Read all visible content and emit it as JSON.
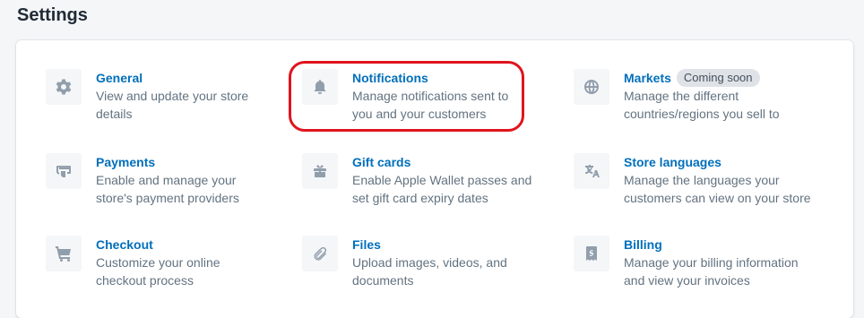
{
  "page": {
    "title": "Settings"
  },
  "settings": [
    {
      "key": "general",
      "icon": "gear-icon",
      "title": "General",
      "description": "View and update your store details",
      "desc_lines": [
        "View and update your store",
        "details"
      ]
    },
    {
      "key": "notifications",
      "icon": "bell-icon",
      "title": "Notifications",
      "description": "Manage notifications sent to you and your customers",
      "desc_lines": [
        "Manage notifications sent to",
        "you and your customers"
      ]
    },
    {
      "key": "markets",
      "icon": "globe-icon",
      "title": "Markets",
      "badge": "Coming soon",
      "description": "Manage the different countries/regions you sell to",
      "desc_lines": [
        "Manage the different",
        "countries/regions you sell to"
      ]
    },
    {
      "key": "payments",
      "icon": "credit-card-icon",
      "title": "Payments",
      "description": "Enable and manage your store's payment providers",
      "desc_lines": [
        "Enable and manage your",
        "store's payment providers"
      ]
    },
    {
      "key": "gift-cards",
      "icon": "gift-icon",
      "title": "Gift cards",
      "description": "Enable Apple Wallet passes and set gift card expiry dates",
      "desc_lines": [
        "Enable Apple Wallet passes and",
        "set gift card expiry dates"
      ]
    },
    {
      "key": "store-languages",
      "icon": "translate-icon",
      "title": "Store languages",
      "description": "Manage the languages your customers can view on your store",
      "desc_lines": [
        "Manage the languages your",
        "customers can view on your store"
      ]
    },
    {
      "key": "checkout",
      "icon": "cart-icon",
      "title": "Checkout",
      "description": "Customize your online checkout process",
      "desc_lines": [
        "Customize your online",
        "checkout process"
      ]
    },
    {
      "key": "files",
      "icon": "paperclip-icon",
      "title": "Files",
      "description": "Upload images, videos, and documents",
      "desc_lines": [
        "Upload images, videos, and",
        "documents"
      ]
    },
    {
      "key": "billing",
      "icon": "receipt-icon",
      "title": "Billing",
      "description": "Manage your billing information and view your invoices",
      "desc_lines": [
        "Manage your billing information",
        "and view your invoices"
      ]
    }
  ],
  "colors": {
    "link": "#006fbb",
    "muted": "#637381",
    "highlight": "#e0141e"
  }
}
